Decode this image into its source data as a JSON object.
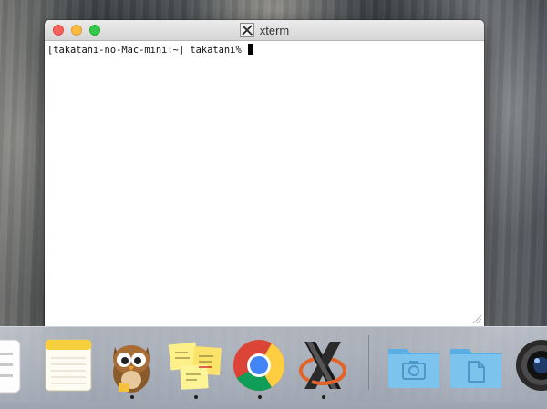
{
  "window": {
    "title": "xterm",
    "title_icon": "x11-icon",
    "controls": [
      "close",
      "minimize",
      "zoom"
    ]
  },
  "terminal": {
    "prompt": "[takatani-no-Mac-mini:~] takatani% "
  },
  "dock": {
    "items": [
      {
        "name": "reminders",
        "icon": "list-icon",
        "running": false
      },
      {
        "name": "notes",
        "icon": "notepad-icon",
        "running": false
      },
      {
        "name": "owl-app",
        "icon": "owl-icon",
        "running": true
      },
      {
        "name": "stickies",
        "icon": "sticky-notes-icon",
        "running": true
      },
      {
        "name": "chrome",
        "icon": "chrome-icon",
        "running": true
      },
      {
        "name": "xquartz",
        "icon": "x11-icon",
        "running": true
      },
      {
        "name": "screenshots-folder",
        "icon": "camera-folder-icon",
        "running": false
      },
      {
        "name": "documents-folder",
        "icon": "document-folder-icon",
        "running": false
      },
      {
        "name": "photo-booth",
        "icon": "camera-lens-icon",
        "running": false
      }
    ]
  },
  "colors": {
    "close": "#fc605c",
    "minimize": "#fdbc40",
    "zoom": "#34c84a",
    "folder": "#64b5e8"
  }
}
